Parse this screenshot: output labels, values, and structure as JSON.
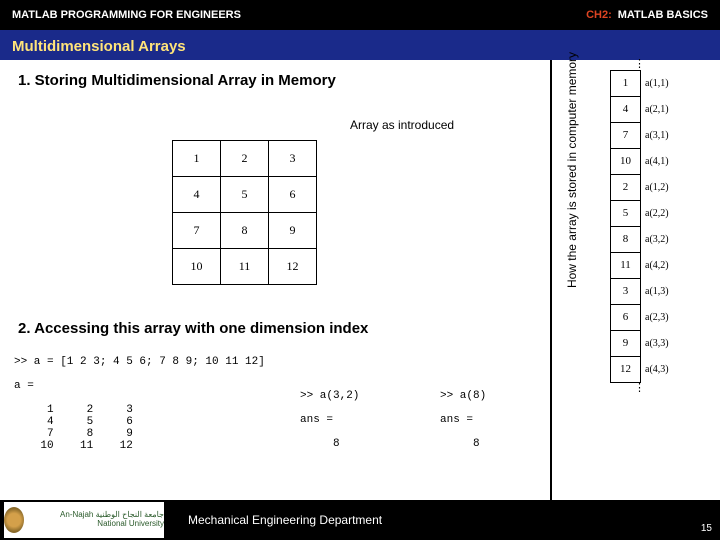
{
  "header": {
    "title_left": "MATLAB PROGRAMMING FOR ENGINEERS",
    "chapter": "CH2:",
    "title_right": "MATLAB BASICS"
  },
  "subtitle": "Multidimensional Arrays",
  "section1": {
    "heading": "1.  Storing Multidimensional Array in Memory",
    "intro_label": "Array as introduced"
  },
  "matrix": {
    "rows": [
      [
        "1",
        "2",
        "3"
      ],
      [
        "4",
        "5",
        "6"
      ],
      [
        "7",
        "8",
        "9"
      ],
      [
        "10",
        "11",
        "12"
      ]
    ]
  },
  "section2": {
    "heading": "2.  Accessing this array with one dimension index"
  },
  "code": {
    "main": ">> a = [1 2 3; 4 5 6; 7 8 9; 10 11 12]\n\na =\n\n     1     2     3\n     4     5     6\n     7     8     9\n    10    11    12",
    "a32": ">> a(3,2)\n\nans =\n\n     8",
    "a8": ">> a(8)\n\nans =\n\n     8"
  },
  "memory": {
    "caption": "How the array is stored in computer memory",
    "cells": [
      {
        "v": "1",
        "l": "a(1,1)"
      },
      {
        "v": "4",
        "l": "a(2,1)"
      },
      {
        "v": "7",
        "l": "a(3,1)"
      },
      {
        "v": "10",
        "l": "a(4,1)"
      },
      {
        "v": "2",
        "l": "a(1,2)"
      },
      {
        "v": "5",
        "l": "a(2,2)"
      },
      {
        "v": "8",
        "l": "a(3,2)"
      },
      {
        "v": "11",
        "l": "a(4,2)"
      },
      {
        "v": "3",
        "l": "a(1,3)"
      },
      {
        "v": "6",
        "l": "a(2,3)"
      },
      {
        "v": "9",
        "l": "a(3,3)"
      },
      {
        "v": "12",
        "l": "a(4,3)"
      }
    ]
  },
  "footer": {
    "logo_text": "جامعة النجاح الوطنية\nAn-Najah National University",
    "dept": "Mechanical Engineering Department",
    "page": "15"
  }
}
